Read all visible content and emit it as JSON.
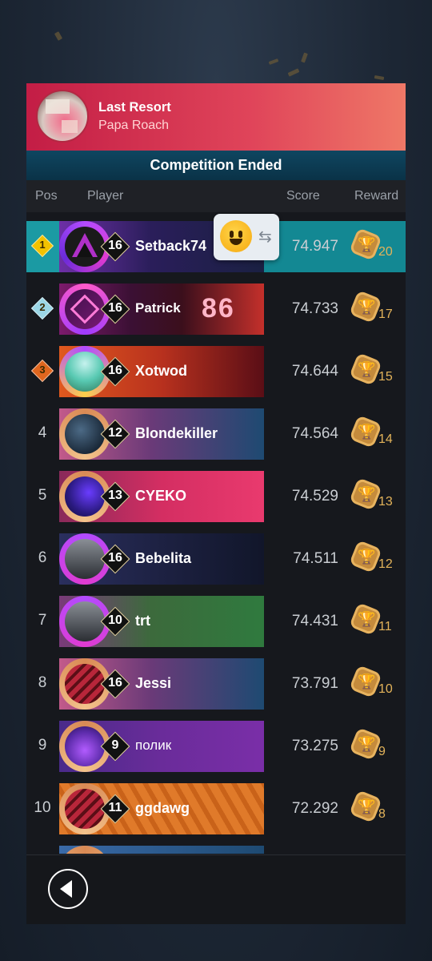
{
  "song": {
    "title": "Last Resort",
    "artist": "Papa Roach"
  },
  "status": "Competition Ended",
  "columns": {
    "pos": "Pos",
    "player": "Player",
    "score": "Score",
    "reward": "Reward"
  },
  "rows": [
    {
      "pos": "1",
      "level": "16",
      "name": "Setback74",
      "score": "74.947",
      "reward": "20",
      "badge_color": "#f2c200"
    },
    {
      "pos": "2",
      "level": "16",
      "name": "Patrick",
      "score": "74.733",
      "reward": "17",
      "badge_color": "#9bd6e6",
      "banner_text": "86"
    },
    {
      "pos": "3",
      "level": "16",
      "name": "Xotwod",
      "score": "74.644",
      "reward": "15",
      "badge_color": "#e0661e"
    },
    {
      "pos": "4",
      "level": "12",
      "name": "Blondekiller",
      "score": "74.564",
      "reward": "14"
    },
    {
      "pos": "5",
      "level": "13",
      "name": "CYEKO",
      "score": "74.529",
      "reward": "13"
    },
    {
      "pos": "6",
      "level": "16",
      "name": "Bebelita",
      "score": "74.511",
      "reward": "12"
    },
    {
      "pos": "7",
      "level": "10",
      "name": "trt",
      "score": "74.431",
      "reward": "11"
    },
    {
      "pos": "8",
      "level": "16",
      "name": "Jessi",
      "score": "73.791",
      "reward": "10"
    },
    {
      "pos": "9",
      "level": "9",
      "name": "полик",
      "score": "73.275",
      "reward": "9"
    },
    {
      "pos": "10",
      "level": "11",
      "name": "ggdawg",
      "score": "72.292",
      "reward": "8"
    }
  ],
  "icons": {
    "reward": "trophy-icon",
    "back": "back-arrow-icon",
    "emoji": "smiley-icon",
    "swap": "swap-icon"
  }
}
